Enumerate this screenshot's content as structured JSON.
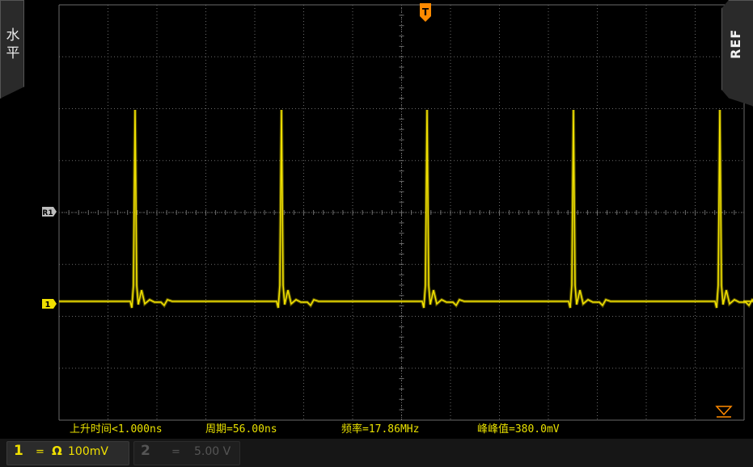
{
  "left_tab": {
    "line1": "水",
    "line2": "平"
  },
  "right_tab": {
    "label": "REF"
  },
  "markers": {
    "trigger": "T",
    "ref": "R1",
    "ch1": "1"
  },
  "measurements": {
    "rise_time": "上升时间<1.000ns",
    "period": "周期=56.00ns",
    "frequency": "频率=17.86MHz",
    "peak_to_peak": "峰峰值=380.0mV"
  },
  "channel1": {
    "number": "1",
    "coupling": "=",
    "impedance": "Ω",
    "scale": "100mV"
  },
  "channel2": {
    "number": "2",
    "coupling": "=",
    "scale": "5.00 V"
  },
  "colors": {
    "trace": "#f0e000",
    "grid": "#6a6a6a",
    "trigger": "#ff8a00",
    "background": "#000000"
  },
  "waveform": {
    "period_ns": 56.0,
    "peaks": 5,
    "peak_to_peak_mV": 380.0
  }
}
